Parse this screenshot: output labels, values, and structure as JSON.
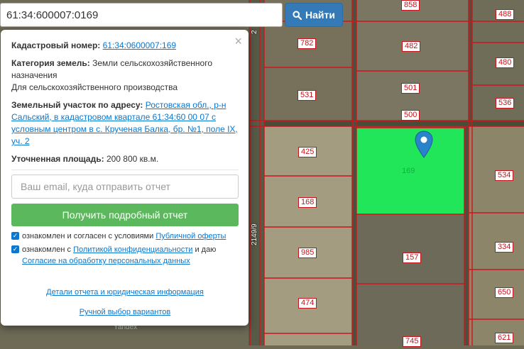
{
  "search": {
    "value": "61:34:600007:0169",
    "button_label": "Найти"
  },
  "map": {
    "parcels": [
      "858",
      "488",
      "782",
      "482",
      "480",
      "531",
      "501",
      "536",
      "500",
      "425",
      "169",
      "534",
      "168",
      "334",
      "985",
      "157",
      "474",
      "650",
      "745",
      "621"
    ],
    "road_label": "2149/9",
    "road_label_top": "2",
    "watermark": "Yandex",
    "highlight_color": "#22e65a"
  },
  "popup": {
    "close": "×",
    "cadastral_label": "Кадастровый номер:",
    "cadastral_value": "61:34:0600007:169",
    "category_label": "Категория земель:",
    "category_value": "Земли сельскохозяйственного назначения",
    "usage": "Для сельскохозяйственного производства",
    "address_label": "Земельный участок по адресу:",
    "address_value": "Ростовская обл., р-н Сальский, в кадастровом квартале 61:34:60 00 07 с условным центром в с. Крученая Балка, бр. №1, поле IX, уч. 2",
    "area_label": "Уточненная площадь:",
    "area_value": "200 800 кв.м.",
    "email_placeholder": "Ваш email, куда отправить отчет",
    "report_button": "Получить подробный отчет",
    "consent1_text": "ознакомлен и согласен с условиями ",
    "consent1_link": "Публичной оферты",
    "consent2_text": "ознакомлен с ",
    "consent2_link": "Политикой конфиденциальности",
    "consent2_tail": " и даю",
    "consent2_link2": "Согласие на обработку персональных данных",
    "details_link": "Детали отчета и юридическая информация",
    "manual_link": "Ручной выбор вариантов"
  }
}
